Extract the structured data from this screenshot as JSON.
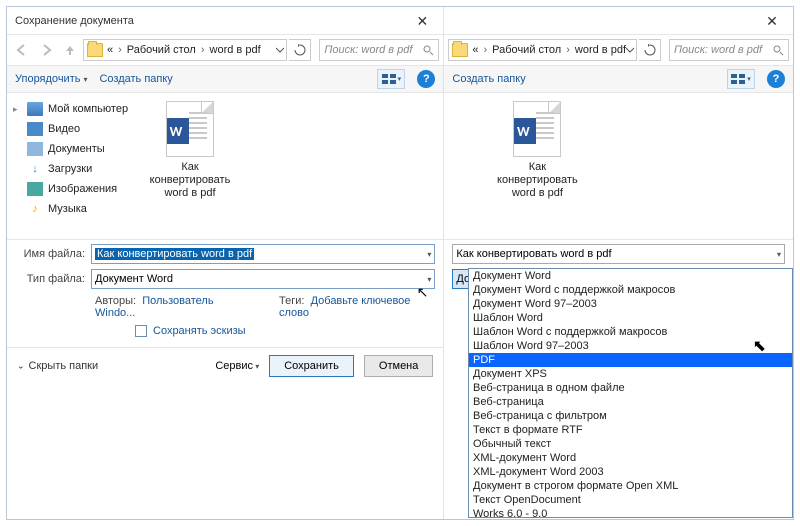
{
  "window_title": "Сохранение документа",
  "breadcrumb": {
    "prefix": "«",
    "p1": "Рабочий стол",
    "p2": "word в pdf"
  },
  "search_placeholder": "Поиск: word в pdf",
  "toolbar": {
    "organize": "Упорядочить",
    "newfolder": "Создать папку"
  },
  "sidebar": {
    "items": [
      {
        "label": "Мой компьютер"
      },
      {
        "label": "Видео"
      },
      {
        "label": "Документы"
      },
      {
        "label": "Загрузки"
      },
      {
        "label": "Изображения"
      },
      {
        "label": "Музыка"
      }
    ]
  },
  "file": {
    "name": "Как конвертировать word в pdf"
  },
  "labels": {
    "filename": "Имя файла:",
    "filetype": "Тип файла:",
    "authors": "Авторы:",
    "tags": "Теги:",
    "author_value": "Пользователь Windo...",
    "tags_value": "Добавьте ключевое слово",
    "save_thumb": "Сохранять эскизы",
    "hide_folders": "Скрыть папки",
    "service": "Сервис",
    "save": "Сохранить",
    "cancel": "Отмена"
  },
  "filename_value": "Как конвертировать word  в  pdf",
  "filetype_value": "Документ Word",
  "right": {
    "filename_value": "Как конвертировать word  в  pdf",
    "filetype_value": "Документ Word"
  },
  "type_options": [
    "Документ Word",
    "Документ Word с поддержкой макросов",
    "Документ Word 97–2003",
    "Шаблон Word",
    "Шаблон Word с поддержкой макросов",
    "Шаблон Word 97–2003",
    "PDF",
    "Документ XPS",
    "Веб-страница в одном файле",
    "Веб-страница",
    "Веб-страница с фильтром",
    "Текст в формате RTF",
    "Обычный текст",
    "XML-документ Word",
    "XML-документ Word 2003",
    "Документ в строгом формате Open XML",
    "Текст OpenDocument",
    "Works 6.0 - 9.0"
  ],
  "highlighted_option_index": 6
}
